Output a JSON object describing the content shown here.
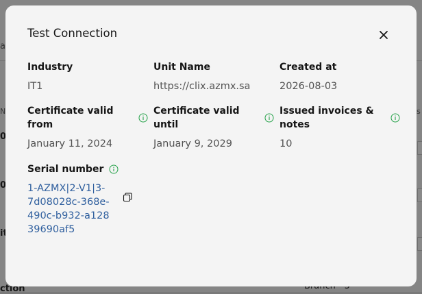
{
  "modal": {
    "title": "Test Connection",
    "fields": {
      "industry": {
        "label": "Industry",
        "value": "IT1"
      },
      "unit_name": {
        "label": "Unit Name",
        "value": "https://clix.azmx.sa"
      },
      "created_at": {
        "label": "Created at",
        "value": "2026-08-03"
      },
      "cert_valid_from": {
        "label": "Certificate valid from",
        "value": "January 11, 2024"
      },
      "cert_valid_until": {
        "label": "Certificate valid until",
        "value": "January 9, 2029"
      },
      "issued_invoices": {
        "label": "Issued invoices & notes",
        "value": "10"
      },
      "serial_number": {
        "label": "Serial number",
        "value": "1-AZMX|2-V1|3-7d08028c-368e-490c-b932-a12839690af5"
      }
    }
  },
  "background": {
    "fragment_a": "a",
    "fragment_n": "N",
    "fragment_0_top": "0",
    "fragment_0_mid": "0",
    "fragment_it": "it",
    "fragment_s": "s",
    "fragment_ction": "ction",
    "fragment_branch": "Branch - 5"
  },
  "colors": {
    "info_icon": "#24a148",
    "link_text": "#2f5f9e"
  }
}
